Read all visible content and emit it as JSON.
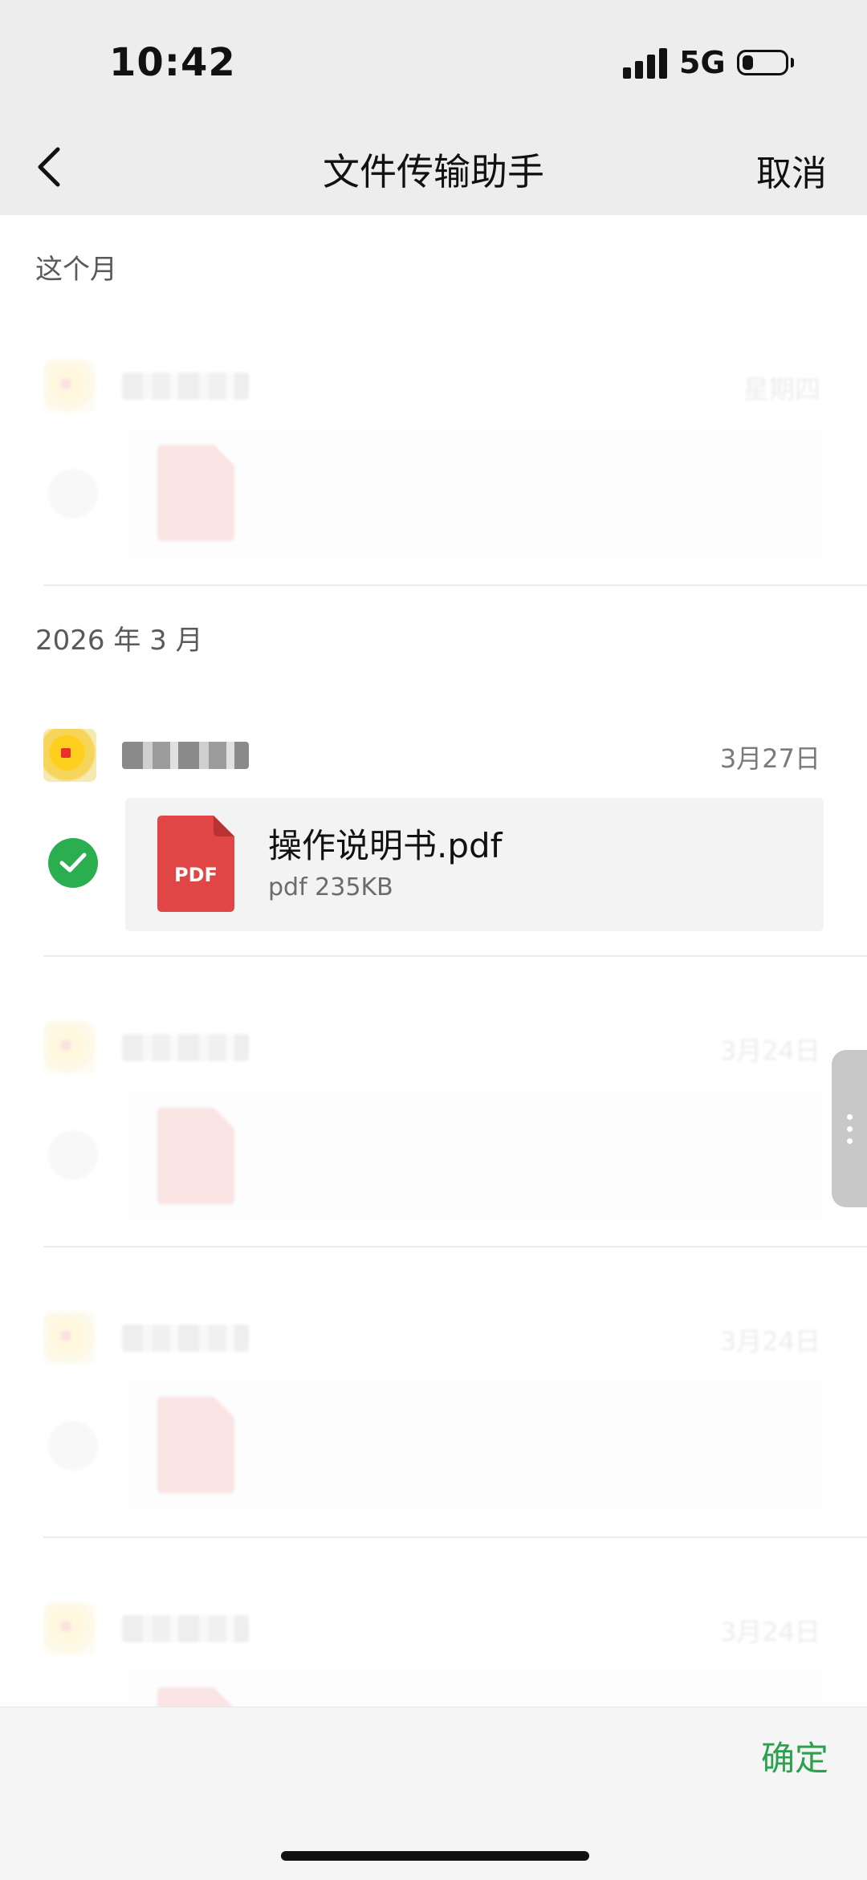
{
  "status_bar": {
    "time": "10:42",
    "network": "5G",
    "battery_level": 0.2
  },
  "nav": {
    "title": "文件传输助手",
    "cancel_label": "取消"
  },
  "sections": [
    {
      "title": "这个月"
    },
    {
      "title": "2026 年 3 月"
    }
  ],
  "messages": [
    {
      "date": "星期四",
      "file_name": "",
      "file_meta": "",
      "selected": false,
      "faded": true
    },
    {
      "date": "3月27日",
      "file_name": "操作说明书.pdf",
      "file_meta": "pdf 235KB",
      "selected": true,
      "faded": false
    },
    {
      "date": "3月24日",
      "file_name": "",
      "file_meta": "",
      "selected": false,
      "faded": true
    },
    {
      "date": "3月24日",
      "file_name": "",
      "file_meta": "",
      "selected": false,
      "faded": true
    },
    {
      "date": "3月24日",
      "file_name": "",
      "file_meta": "",
      "selected": false,
      "faded": true
    }
  ],
  "file_icon": {
    "label": "PDF",
    "color": "#e04646"
  },
  "colors": {
    "accent_green": "#2ba14f",
    "check_green": "#2aae4f"
  },
  "bottom": {
    "confirm_label": "确定"
  }
}
